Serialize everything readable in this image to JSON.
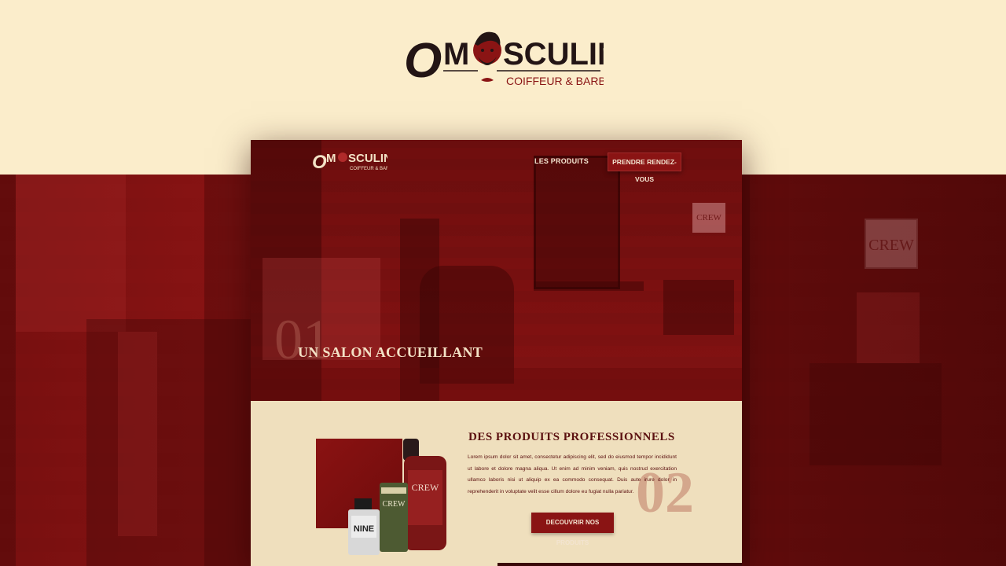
{
  "brand": {
    "logo_o": "O",
    "logo_m": "M",
    "logo_rest": "SCULIN",
    "tagline": "COIFFEUR & BARBIER"
  },
  "background": {
    "sign_text": "CREW"
  },
  "mockup": {
    "nav": {
      "products_link": "LES PRODUITS",
      "appointment_button": "PRENDRE RENDEZ-VOUS"
    },
    "hero": {
      "number": "01",
      "title": "UN SALON ACCUEILLANT",
      "sign_text": "CREW"
    },
    "products_section": {
      "number": "02",
      "title": "DES PRODUITS PROFESSIONNELS",
      "text": "Lorem ipsum dolor sit amet, consectetur adipiscing elit, sed do eiusmod tempor incididunt ut labore et dolore magna aliqua. Ut enim ad minim veniam, quis nostrud exercitation ullamco laboris nisi ut aliquip ex ea commodo consequat. Duis aute irure dolor in reprehenderit in voluptate velit esse cillum dolore eu fugiat nulla pariatur.",
      "button": "DECOUVRIR NOS PRODUITS",
      "product_labels": {
        "big_bottle": "CREW",
        "tube": "CREW",
        "small_bottle": "NINE"
      }
    }
  },
  "colors": {
    "cream": "#fbedcb",
    "dark_red": "#8a1414",
    "text_red": "#5b1010",
    "dark": "#231515"
  }
}
